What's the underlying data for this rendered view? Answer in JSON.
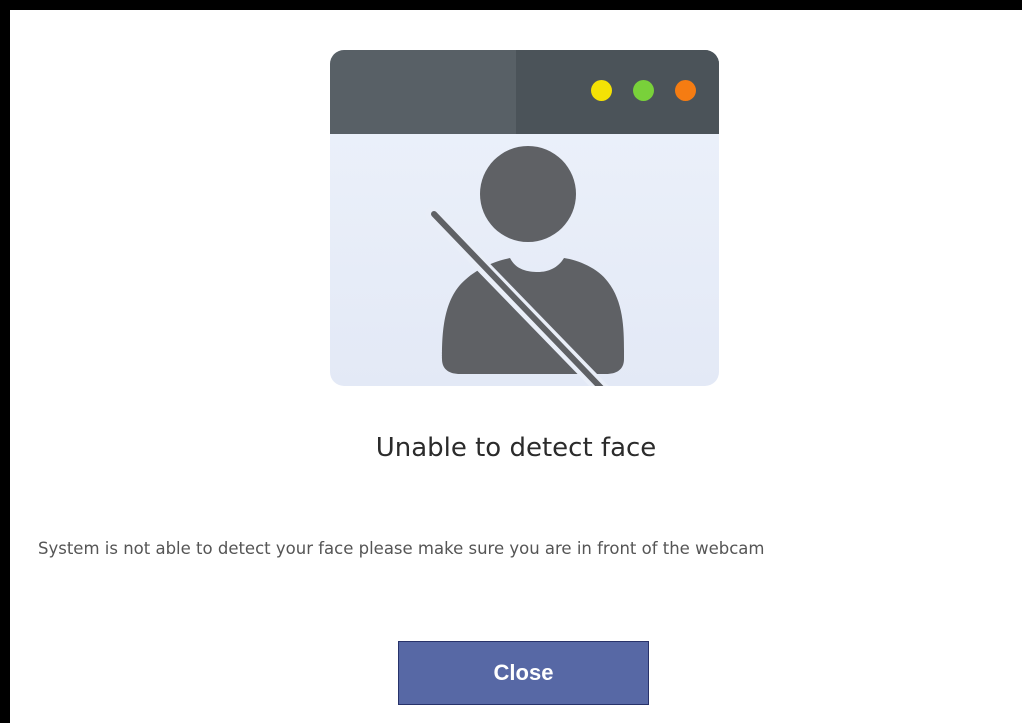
{
  "dialog": {
    "title": "Unable to detect face",
    "message": "System is not able to detect your face please make sure you are in front of the webcam",
    "close_label": "Close"
  },
  "illustration": {
    "icon": "no-face-icon",
    "window_dots": [
      "yellow",
      "green",
      "orange"
    ]
  },
  "colors": {
    "titlebar": "#586066",
    "titlebar_dark": "#4b5359",
    "dot_yellow": "#f4e205",
    "dot_green": "#79d13a",
    "dot_orange": "#f57c12",
    "person": "#5f6165",
    "button_bg": "#5768a5",
    "button_border": "#27326a"
  }
}
